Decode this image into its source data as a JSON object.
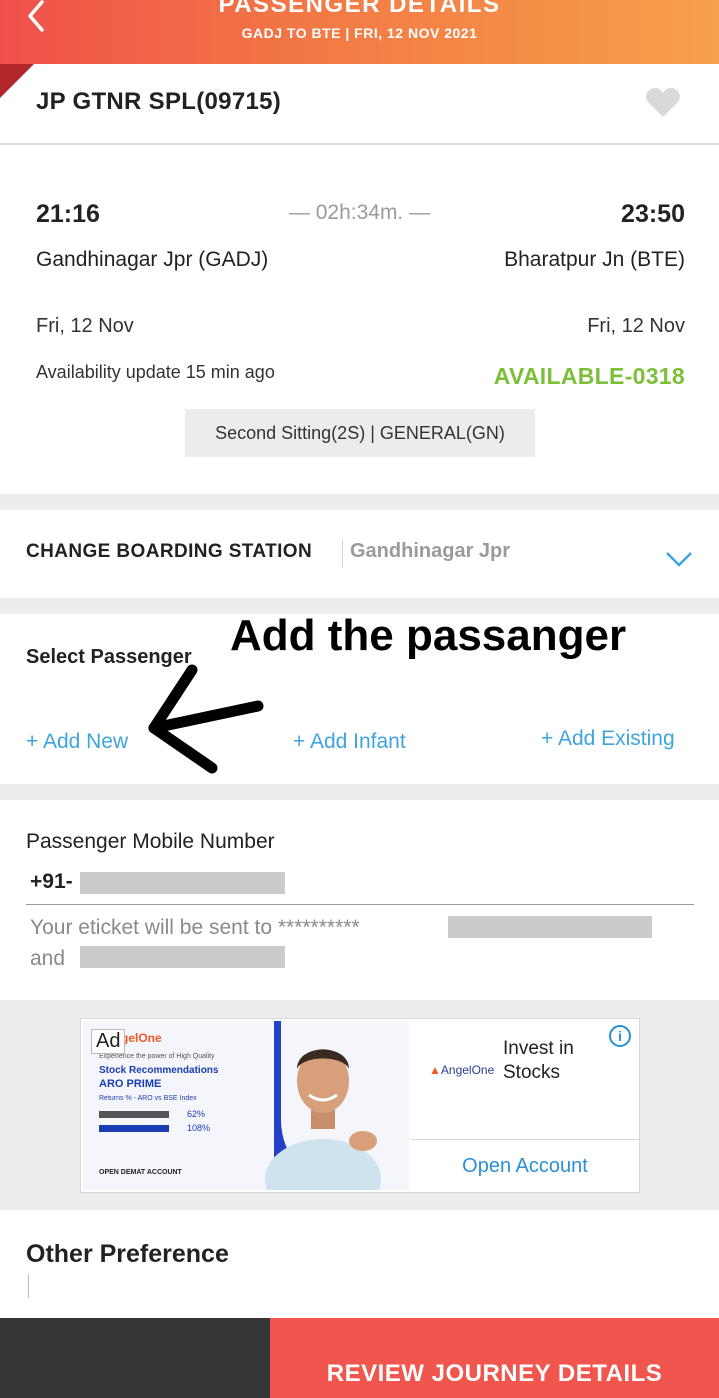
{
  "header": {
    "title": "PASSENGER DETAILS",
    "subtitle": "GADJ TO BTE |  FRI, 12 NOV  2021"
  },
  "train": {
    "name": "JP GTNR SPL(09715)",
    "departure_time": "21:16",
    "arrival_time": "23:50",
    "duration": "— 02h:34m. —",
    "from_station": "Gandhinagar Jpr (GADJ)",
    "to_station": "Bharatpur Jn (BTE)",
    "from_date": "Fri, 12 Nov",
    "to_date": "Fri, 12 Nov",
    "availability_update": "Availability update 15 min ago",
    "availability_status": "AVAILABLE-0318",
    "class_quota": "Second Sitting(2S) | GENERAL(GN)"
  },
  "boarding": {
    "label": "CHANGE BOARDING STATION",
    "value": "Gandhinagar Jpr"
  },
  "passenger": {
    "label": "Select Passenger",
    "add_new": "+ Add New",
    "add_infant": "+ Add Infant",
    "add_existing": "+ Add Existing",
    "annotation": "Add the passanger"
  },
  "mobile": {
    "label": "Passenger Mobile Number",
    "prefix": "+91-",
    "eticket_line1": "Your eticket will be sent to **********",
    "eticket_line2": "and"
  },
  "ad": {
    "tag": "Ad",
    "brand": "gelOne",
    "tagline": "Experience the power of High Quality",
    "headline": "Stock Recommendations",
    "aro": "ARO PRIME",
    "returns": "Returns % - ARO vs BSE Index",
    "bar1": "62%",
    "bar2": "108%",
    "cta_small": "OPEN DEMAT ACCOUNT",
    "logo": "AngelOne",
    "invest": "Invest in Stocks",
    "open_account": "Open Account",
    "info": "i"
  },
  "other": {
    "label": "Other Preference"
  },
  "footer": {
    "button": "REVIEW JOURNEY DETAILS"
  },
  "colors": {
    "header_start": "#f0504a",
    "header_end": "#f6a04a",
    "available": "#7cc03a",
    "link": "#3fa3e0",
    "footer_button": "#f0564d"
  }
}
